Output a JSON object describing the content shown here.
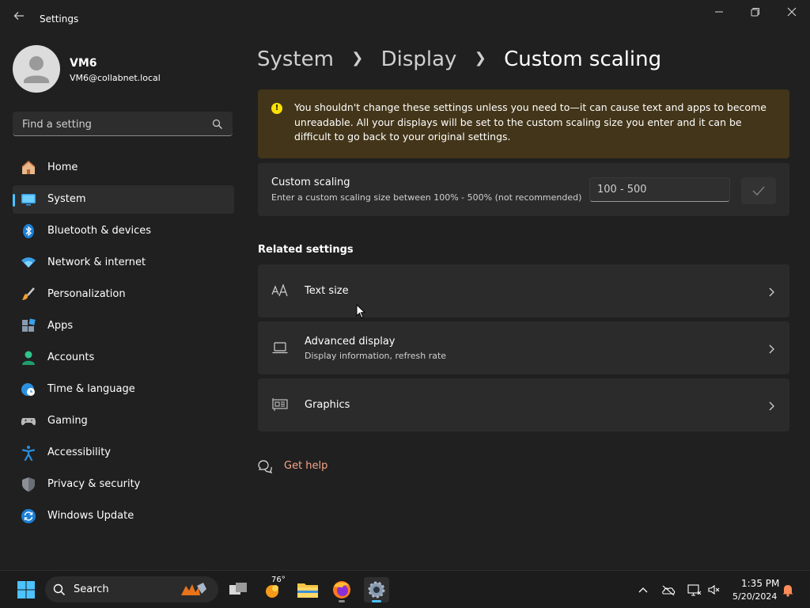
{
  "window": {
    "title": "Settings"
  },
  "profile": {
    "name": "VM6",
    "email": "VM6@collabnet.local"
  },
  "sidebar": {
    "search_placeholder": "Find a setting",
    "items": [
      {
        "label": "Home",
        "icon": "home-icon",
        "selected": false
      },
      {
        "label": "System",
        "icon": "system-icon",
        "selected": true
      },
      {
        "label": "Bluetooth & devices",
        "icon": "bluetooth-icon",
        "selected": false
      },
      {
        "label": "Network & internet",
        "icon": "wifi-icon",
        "selected": false
      },
      {
        "label": "Personalization",
        "icon": "brush-icon",
        "selected": false
      },
      {
        "label": "Apps",
        "icon": "apps-icon",
        "selected": false
      },
      {
        "label": "Accounts",
        "icon": "accounts-icon",
        "selected": false
      },
      {
        "label": "Time & language",
        "icon": "globe-clock-icon",
        "selected": false
      },
      {
        "label": "Gaming",
        "icon": "gamepad-icon",
        "selected": false
      },
      {
        "label": "Accessibility",
        "icon": "accessibility-icon",
        "selected": false
      },
      {
        "label": "Privacy & security",
        "icon": "shield-icon",
        "selected": false
      },
      {
        "label": "Windows Update",
        "icon": "update-icon",
        "selected": false
      }
    ]
  },
  "breadcrumb": {
    "part1": "System",
    "part2": "Display",
    "current": "Custom scaling"
  },
  "warning": {
    "text": "You shouldn't change these settings unless you need to—it can cause text and apps to become unreadable. All your displays will be set to the custom scaling size you enter and it can be difficult to go back to your original settings."
  },
  "custom_scaling": {
    "title": "Custom scaling",
    "description": "Enter a custom scaling size between 100% - 500% (not recommended)",
    "input_placeholder": "100 - 500"
  },
  "related": {
    "title": "Related settings",
    "items": [
      {
        "title": "Text size",
        "subtitle": ""
      },
      {
        "title": "Advanced display",
        "subtitle": "Display information, refresh rate"
      },
      {
        "title": "Graphics",
        "subtitle": ""
      }
    ]
  },
  "help": {
    "label": "Get help"
  },
  "taskbar": {
    "search_label": "Search",
    "weather_temp": "76°",
    "time": "1:35 PM",
    "date": "5/20/2024"
  },
  "colors": {
    "background": "#202020",
    "card": "#2b2b2b",
    "accent": "#4cc2ff",
    "warning_bg": "#433519",
    "warning_icon": "#fce100",
    "link": "#f7a58a"
  }
}
